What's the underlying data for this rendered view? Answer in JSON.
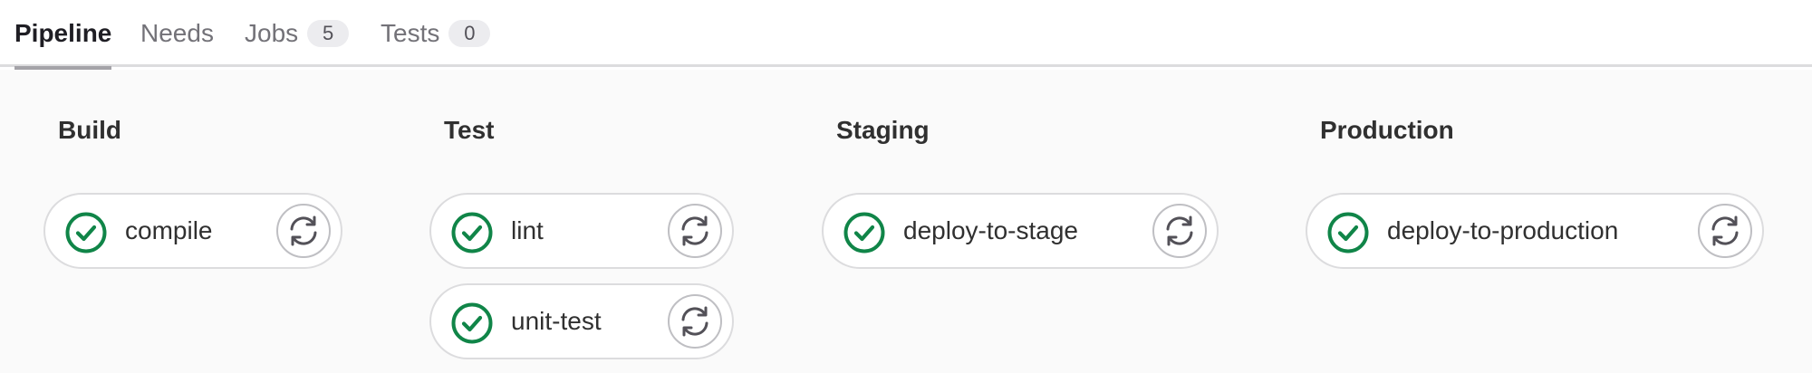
{
  "tabs": [
    {
      "label": "Pipeline",
      "count": null,
      "active": true
    },
    {
      "label": "Needs",
      "count": null,
      "active": false
    },
    {
      "label": "Jobs",
      "count": "5",
      "active": false
    },
    {
      "label": "Tests",
      "count": "0",
      "active": false
    }
  ],
  "colors": {
    "success": "#108548",
    "border": "#dcdcde",
    "graph_bg": "#fafafa"
  },
  "icons": {
    "status": "check-circle-icon",
    "retry": "retry-icon"
  },
  "stages": [
    {
      "title": "Build",
      "jobs": [
        {
          "name": "compile",
          "status": "success"
        }
      ]
    },
    {
      "title": "Test",
      "jobs": [
        {
          "name": "lint",
          "status": "success"
        },
        {
          "name": "unit-test",
          "status": "success"
        }
      ]
    },
    {
      "title": "Staging",
      "jobs": [
        {
          "name": "deploy-to-stage",
          "status": "success"
        }
      ]
    },
    {
      "title": "Production",
      "jobs": [
        {
          "name": "deploy-to-production",
          "status": "success"
        }
      ]
    }
  ]
}
